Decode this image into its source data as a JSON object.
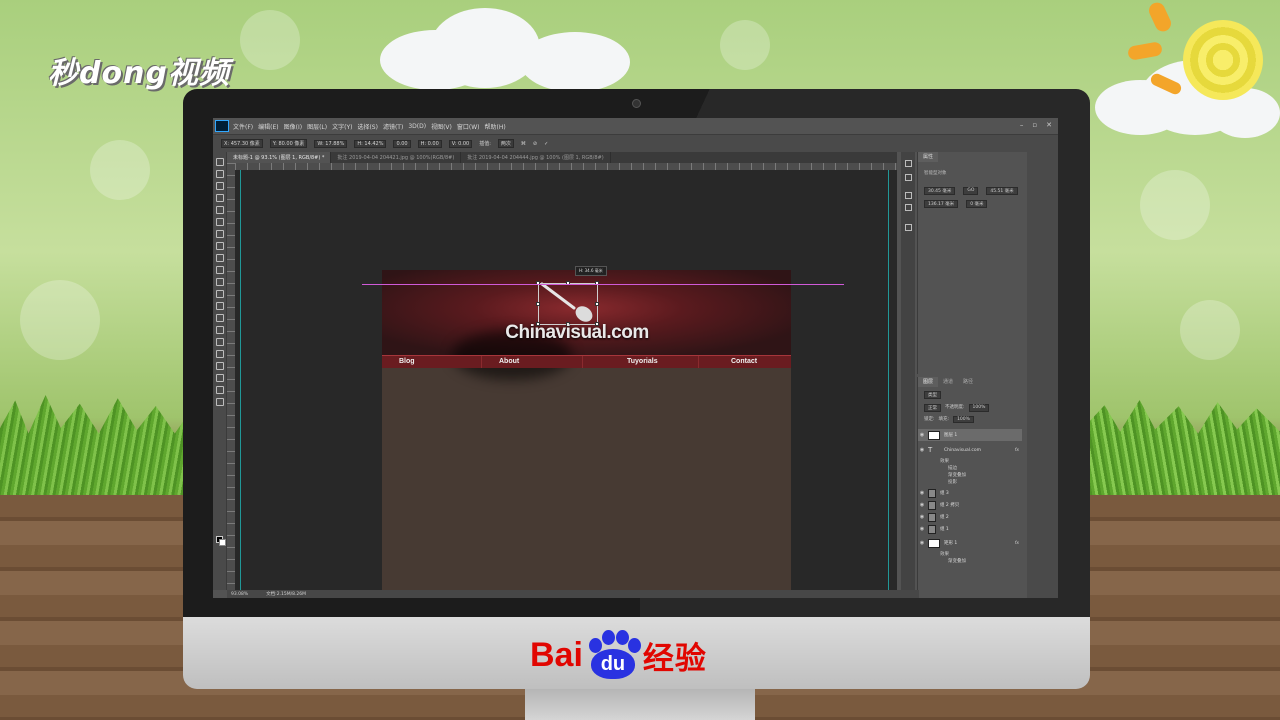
{
  "branding": {
    "top_logo": "秒dong视频",
    "baidu_left": "Bai",
    "baidu_paw": "du",
    "baidu_right": "经验"
  },
  "photoshop": {
    "menu": [
      "文件(F)",
      "编辑(E)",
      "图像(I)",
      "图层(L)",
      "文字(Y)",
      "选择(S)",
      "滤镜(T)",
      "3D(D)",
      "视图(V)",
      "窗口(W)",
      "帮助(H)"
    ],
    "window_buttons": [
      "–",
      "▫",
      "✕"
    ],
    "options": {
      "x": "X: 457.30 像素",
      "y": "Y: 80.00 像素",
      "w": "W: 17.88%",
      "h": "H: 14.42%",
      "rotate": "0.00",
      "h_skew": "H: 0.00",
      "v_skew": "V: 0.00",
      "interp_label": "插值:",
      "interp_value": "两次"
    },
    "tabs": [
      "未标题-1 @ 93.1% (图层 1, RGB/8#) *",
      "批注 2019-04-04 204421.jpg @ 100%(RGB/8#)",
      "批注 2019-04-04 204444.jpg @ 100% (图层 1, RGB/8#)"
    ],
    "measure_tip": "H: 34.6 毫米",
    "site_title": "Chinavisual.com",
    "nav": [
      "Blog",
      "About",
      "Tuyorials",
      "Contact"
    ],
    "status": {
      "zoom": "93.08%",
      "doc": "文档:2.15M/8.26M"
    },
    "properties": {
      "tab": "属性",
      "subtitle": "智能型对象",
      "w_value": "30.45 毫米",
      "go_label": "GO",
      "h_value": "45.51 毫米",
      "x_value": "136.17 毫米",
      "y_value": "0 毫米"
    },
    "layers": {
      "tabs": [
        "图层",
        "通道",
        "路径"
      ],
      "search": "类型",
      "blend": "正常",
      "opacity_label": "不透明度:",
      "opacity": "100%",
      "fill_label": "填充:",
      "fill": "100%",
      "lock_label": "锁定:",
      "rows": [
        "图层 1",
        "Chinavisual.com",
        "组 3",
        "组 2 拷贝",
        "组 2",
        "组 1",
        "矩形 1"
      ],
      "effects_label": "效果",
      "text_effects": [
        "描边",
        "渐变叠加",
        "投影"
      ],
      "rect_effect": "渐变叠加",
      "fx": "fx"
    }
  }
}
